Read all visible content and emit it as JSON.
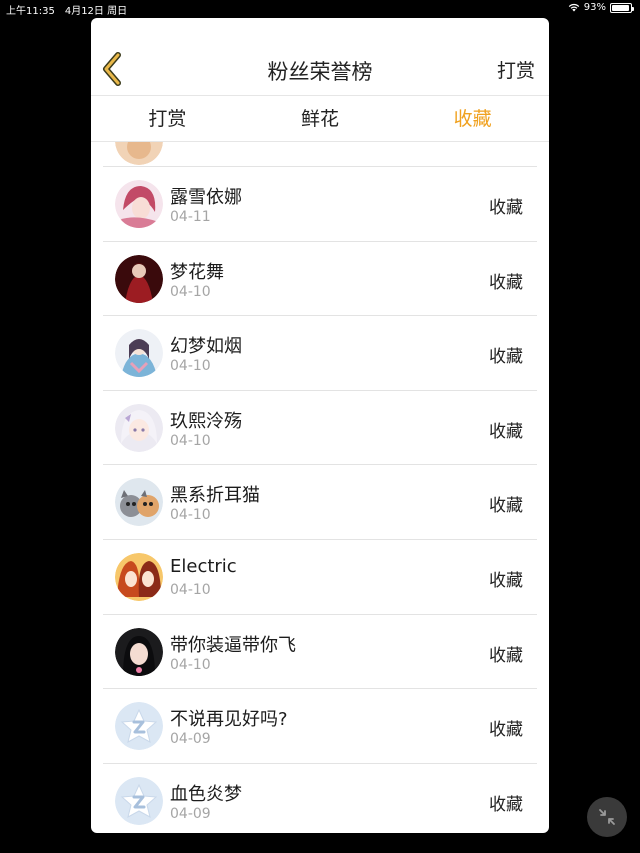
{
  "status_bar": {
    "time": "上午11:35",
    "date": "4月12日 周日",
    "battery": "93%",
    "battery_level": 0.93
  },
  "nav": {
    "title": "粉丝荣誉榜",
    "action": "打赏",
    "back_icon": "chevron-left-icon",
    "accent": "#f0a11f"
  },
  "tabs": [
    {
      "label": "打赏",
      "active": false
    },
    {
      "label": "鲜花",
      "active": false
    },
    {
      "label": "收藏",
      "active": true
    }
  ],
  "list": [
    {
      "name": "",
      "date": "",
      "action": "",
      "avatar": "peach-avatar"
    },
    {
      "name": "露雪依娜",
      "date": "04-11",
      "action": "收藏",
      "avatar": "pink-hair-avatar"
    },
    {
      "name": "梦花舞",
      "date": "04-10",
      "action": "收藏",
      "avatar": "red-dress-avatar"
    },
    {
      "name": "幻梦如烟",
      "date": "04-10",
      "action": "收藏",
      "avatar": "kimono-avatar"
    },
    {
      "name": "玖熙泠殇",
      "date": "04-10",
      "action": "收藏",
      "avatar": "white-hair-avatar"
    },
    {
      "name": "黑系折耳猫",
      "date": "04-10",
      "action": "收藏",
      "avatar": "cats-avatar"
    },
    {
      "name": "Electric",
      "date": "04-10",
      "action": "收藏",
      "avatar": "two-girls-avatar"
    },
    {
      "name": "带你装逼带你飞",
      "date": "04-10",
      "action": "收藏",
      "avatar": "dark-hair-avatar"
    },
    {
      "name": "不说再见好吗?",
      "date": "04-09",
      "action": "收藏",
      "avatar": "default-star-avatar"
    },
    {
      "name": "血色炎梦",
      "date": "04-09",
      "action": "收藏",
      "avatar": "default-star-avatar"
    }
  ],
  "float_button": {
    "icon": "collapse-arrows-icon"
  }
}
